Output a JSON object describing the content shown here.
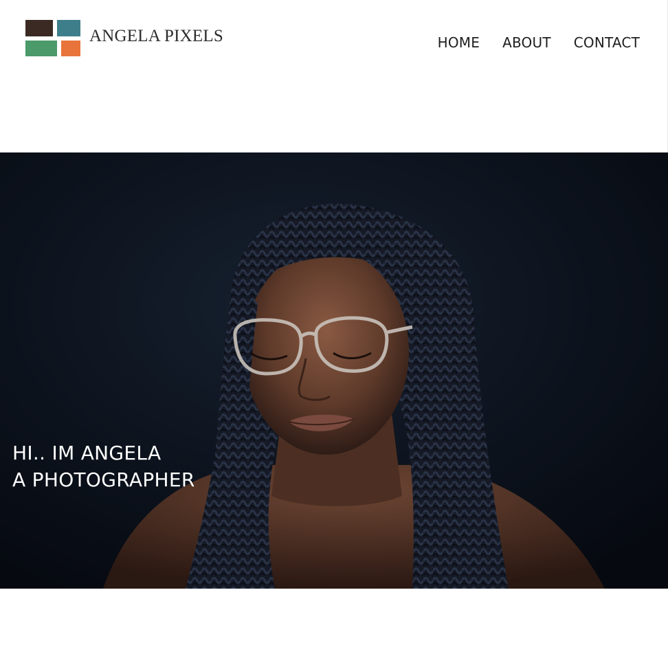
{
  "brand": {
    "name": "ANGELA PIXELS",
    "logo_colors": [
      "#3b2a24",
      "#3d7e8a",
      "#4a9a6a",
      "#e8743b"
    ]
  },
  "nav": {
    "items": [
      {
        "label": "HOME"
      },
      {
        "label": "ABOUT"
      },
      {
        "label": "CONTACT"
      }
    ]
  },
  "hero": {
    "line1": "HI.. IM ANGELA",
    "line2": "A PHOTOGRAPHER",
    "photo": "portrait-woman-braids-glasses",
    "background_color": "#0b0f18"
  }
}
